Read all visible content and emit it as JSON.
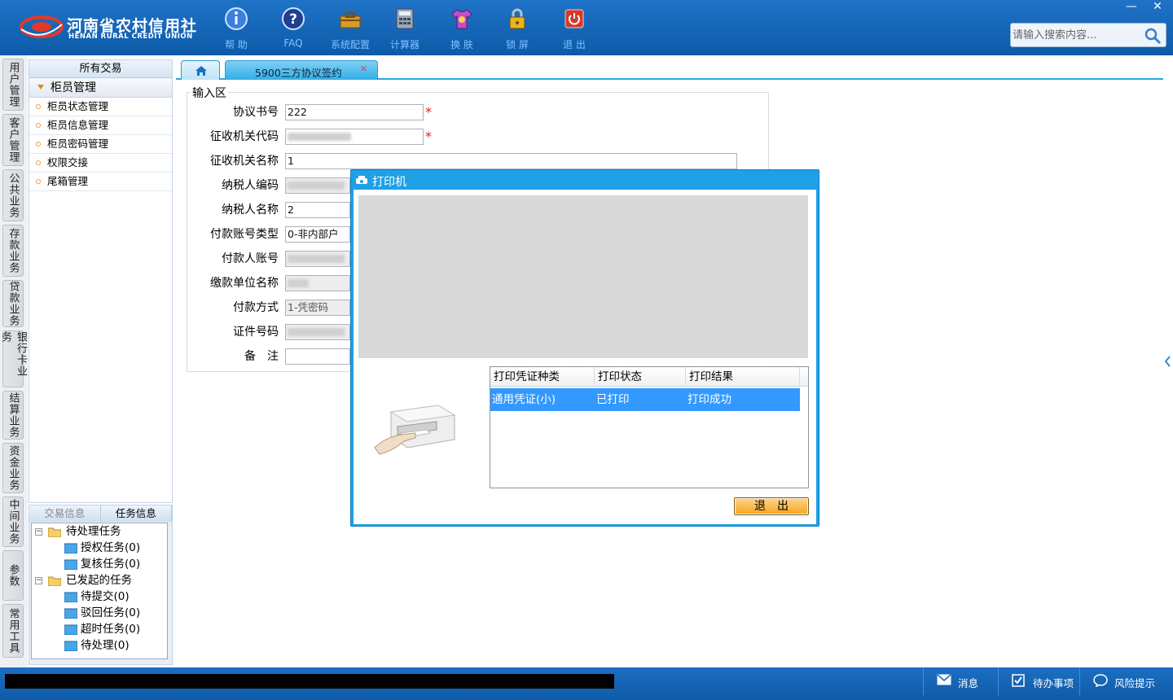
{
  "header": {
    "logo_cn": "河南省农村信用社",
    "logo_en": "HENAN RURAL CREDIT UNION",
    "toolbar": [
      {
        "name": "help",
        "label": "帮 助",
        "icon": "info-icon"
      },
      {
        "name": "faq",
        "label": "FAQ",
        "icon": "question-icon"
      },
      {
        "name": "settings",
        "label": "系统配置",
        "icon": "toolbox-icon"
      },
      {
        "name": "calculator",
        "label": "计算器",
        "icon": "calculator-icon"
      },
      {
        "name": "skin",
        "label": "换 肤",
        "icon": "shirt-icon"
      },
      {
        "name": "lock",
        "label": "锁 屏",
        "icon": "lock-icon"
      },
      {
        "name": "exit",
        "label": "退 出",
        "icon": "power-icon"
      }
    ],
    "search_placeholder": "请输入搜索内容...",
    "window_min": "—",
    "window_close": "✕"
  },
  "vnav": [
    "用户管理",
    "客户管理",
    "公共业务",
    "存款业务",
    "贷款业务",
    "银行卡业务",
    "结算业务",
    "资金业务",
    "中间业务",
    "参数",
    "常用工具"
  ],
  "menu": {
    "header": "所有交易",
    "group": "柜员管理",
    "items": [
      "柜员状态管理",
      "柜员信息管理",
      "柜员密码管理",
      "权限交接",
      "尾箱管理"
    ]
  },
  "tasks": {
    "tabs": [
      "交易信息",
      "任务信息"
    ],
    "pending": "待处理任务",
    "pending_children": [
      "授权任务(0)",
      "复核任务(0)"
    ],
    "initiated": "已发起的任务",
    "initiated_children": [
      "待提交(0)",
      "驳回任务(0)",
      "超时任务(0)",
      "待处理(0)"
    ]
  },
  "tabs": {
    "active": "5900三方协议签约",
    "close": "✕"
  },
  "form": {
    "legend": "输入区",
    "fields": [
      {
        "label": "协议书号",
        "value": "222",
        "required": true
      },
      {
        "label": "征收机关代码",
        "value": "",
        "required": true
      },
      {
        "label": "征收机关名称",
        "value": "1"
      },
      {
        "label": "纳税人编码",
        "value": ""
      },
      {
        "label": "纳税人名称",
        "value": "2"
      },
      {
        "label": "付款账号类型",
        "value": "0-非内部户"
      },
      {
        "label": "付款人账号",
        "value": ""
      },
      {
        "label": "缴款单位名称",
        "value": ""
      },
      {
        "label": "付款方式",
        "value": "1-凭密码"
      },
      {
        "label": "证件号码",
        "value": ""
      },
      {
        "label": "备　注",
        "value": ""
      }
    ],
    "required_mark": "*"
  },
  "dialog": {
    "title": "打印机",
    "columns": [
      "打印凭证种类",
      "打印状态",
      "打印结果"
    ],
    "rows": [
      {
        "type": "通用凭证(小)",
        "status": "已打印",
        "result": "打印成功"
      }
    ],
    "exit_label": "退出"
  },
  "status": {
    "message": "消息",
    "todo": "待办事项",
    "risk": "风险提示"
  },
  "colors": {
    "header_blue": "#1668bb",
    "dialog_blue": "#1fa0e6",
    "selection": "#3399ff",
    "required": "#e02020"
  }
}
